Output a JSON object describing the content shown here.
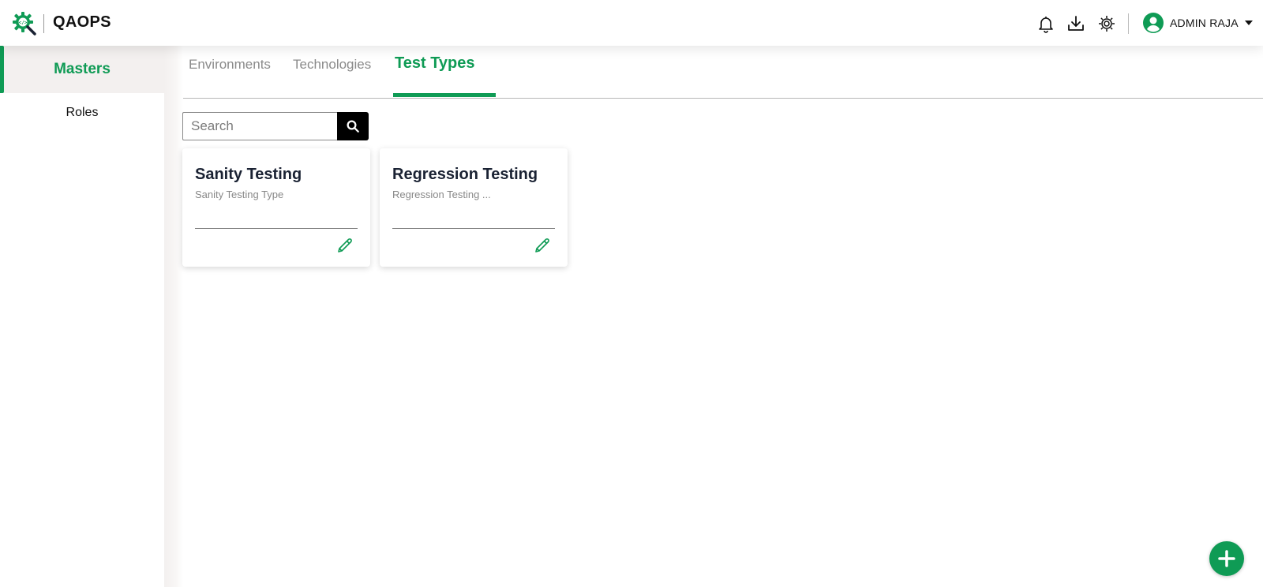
{
  "app": {
    "title": "QAOPS"
  },
  "colors": {
    "accent": "#0f9b55",
    "title": "#1a2233",
    "muted": "#8a8a8a"
  },
  "header": {
    "icons": [
      "bell-icon",
      "download-icon",
      "settings-gear-icon"
    ],
    "user": {
      "name": "ADMIN RAJA",
      "avatar_icon": "user-circle-icon",
      "menu_icon": "caret-down-icon"
    }
  },
  "sidebar": {
    "items": [
      {
        "label": "Masters",
        "active": true
      },
      {
        "label": "Roles",
        "active": false
      }
    ]
  },
  "tabs": [
    {
      "label": "Environments",
      "active": false
    },
    {
      "label": "Technologies",
      "active": false
    },
    {
      "label": "Test Types",
      "active": true
    }
  ],
  "search": {
    "placeholder": "Search",
    "value": "",
    "icon": "search-icon"
  },
  "cards": [
    {
      "title": "Sanity Testing",
      "subtitle": "Sanity Testing Type",
      "action_icon": "pencil-edit-icon"
    },
    {
      "title": "Regression Testing",
      "subtitle": "Regression Testing ...",
      "action_icon": "pencil-edit-icon"
    }
  ],
  "fab": {
    "icon": "plus-icon"
  }
}
